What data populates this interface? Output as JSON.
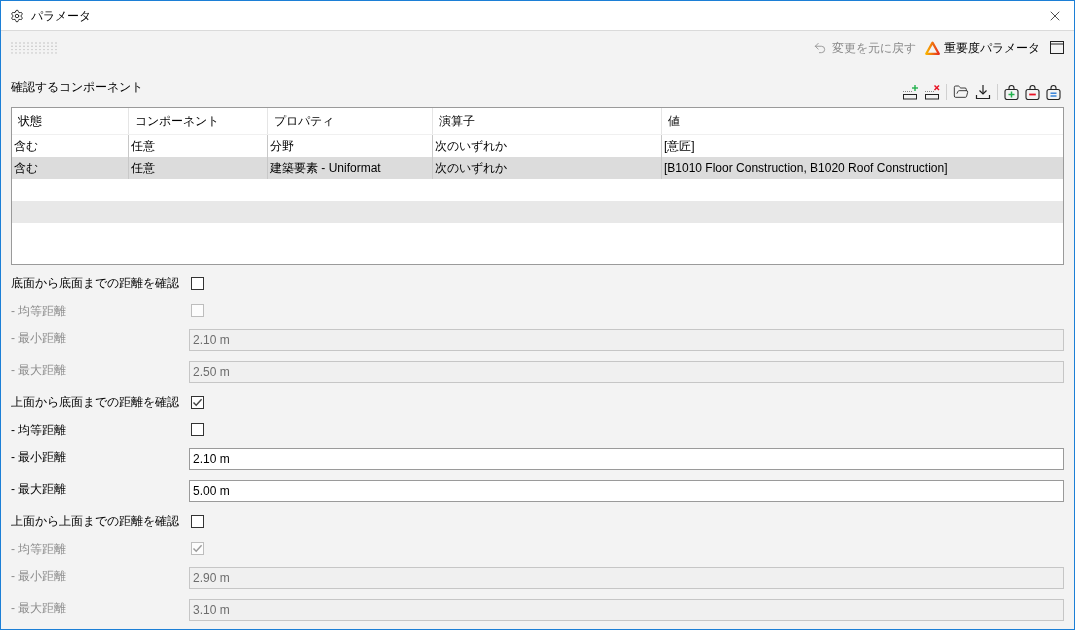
{
  "window": {
    "title": "パラメータ"
  },
  "toolbar": {
    "undo": {
      "label": "変更を元に戻す",
      "disabled": true
    },
    "importance_button": {
      "label": "重要度パラメータ"
    }
  },
  "components": {
    "title": "確認するコンポーネント",
    "table": {
      "columns": [
        "状態",
        "コンポーネント",
        "プロパティ",
        "演算子",
        "値"
      ],
      "rows": [
        {
          "cells": [
            "含む",
            "任意",
            "分野",
            "次のいずれか",
            "[意匠]"
          ],
          "selected": false
        },
        {
          "cells": [
            "含む",
            "任意",
            "建築要素 - Uniformat",
            "次のいずれか",
            "[B1010 Floor Construction, B1020 Roof Construction]"
          ],
          "selected": true
        }
      ]
    }
  },
  "checks": [
    {
      "label": "底面から底面までの距離を確認",
      "checked": false,
      "items": [
        {
          "kind": "checkbox",
          "label": "- 均等距離",
          "checked": false,
          "disabled": true
        },
        {
          "kind": "input",
          "label": "- 最小距離",
          "value": "2.10 m",
          "disabled": true
        },
        {
          "kind": "input",
          "label": "- 最大距離",
          "value": "2.50 m",
          "disabled": true
        }
      ]
    },
    {
      "label": "上面から底面までの距離を確認",
      "checked": true,
      "items": [
        {
          "kind": "checkbox",
          "label": "- 均等距離",
          "checked": false,
          "disabled": false
        },
        {
          "kind": "input",
          "label": "- 最小距離",
          "value": "2.10 m",
          "disabled": false
        },
        {
          "kind": "input",
          "label": "- 最大距離",
          "value": "5.00 m",
          "disabled": false
        }
      ]
    },
    {
      "label": "上面から上面までの距離を確認",
      "checked": false,
      "items": [
        {
          "kind": "checkbox",
          "label": "- 均等距離",
          "checked": true,
          "disabled": true
        },
        {
          "kind": "input",
          "label": "- 最小距離",
          "value": "2.90 m",
          "disabled": true
        },
        {
          "kind": "input",
          "label": "- 最大距離",
          "value": "3.10 m",
          "disabled": true
        }
      ]
    }
  ]
}
